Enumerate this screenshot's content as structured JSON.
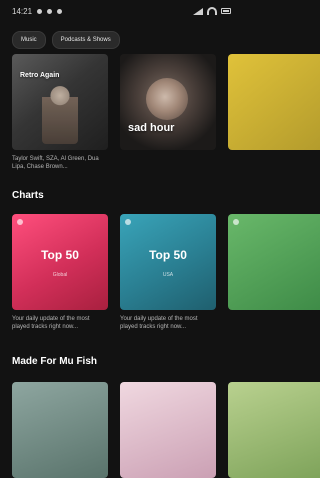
{
  "status": {
    "time": "14:21"
  },
  "filters": [
    "Music",
    "Podcasts & Shows"
  ],
  "row1": [
    {
      "art_text": "Retro Again",
      "description": "Taylor Swift, SZA, Al Green, Dua Lipa, Chase Brown..."
    },
    {
      "art_text": "sad hour",
      "description": ""
    },
    {
      "art_text": "",
      "description": ""
    }
  ],
  "sections": {
    "charts": "Charts",
    "made_for": "Made For Mu Fish"
  },
  "charts": [
    {
      "title": "Top 50",
      "subtitle": "Global",
      "description": "Your daily update of the most played tracks right now..."
    },
    {
      "title": "Top 50",
      "subtitle": "USA",
      "description": "Your daily update of the most played tracks right now..."
    },
    {
      "title": "",
      "subtitle": "",
      "description": ""
    }
  ],
  "made_for": [
    {
      "title": ""
    },
    {
      "title": ""
    },
    {
      "title": ""
    }
  ],
  "colors": {
    "background": "#121212",
    "chip_bg": "#2a2a2a",
    "top50_global": "#ff4f7d",
    "top50_usa": "#39a4b9"
  }
}
